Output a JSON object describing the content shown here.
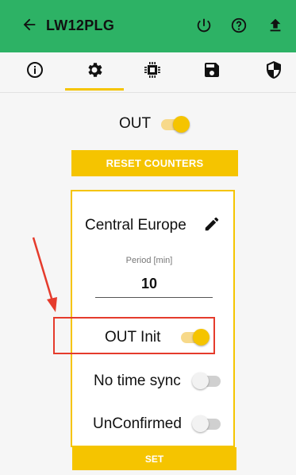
{
  "app": {
    "title": "LW12PLG",
    "accent": "#2db265",
    "icons": [
      "back-arrow-icon",
      "power-icon",
      "help-icon",
      "upload-icon"
    ]
  },
  "tabs": [
    {
      "icon": "info-icon",
      "selected": false
    },
    {
      "icon": "gear-icon",
      "selected": true
    },
    {
      "icon": "chip-icon",
      "selected": false
    },
    {
      "icon": "save-icon",
      "selected": false
    },
    {
      "icon": "shield-icon",
      "selected": false
    }
  ],
  "out_toggle": {
    "label": "OUT",
    "on": true
  },
  "reset_button": {
    "label": "RESET COUNTERS"
  },
  "card": {
    "zone": "Central Europe",
    "period_label": "Period [min]",
    "period_value": "10",
    "out_init": {
      "label": "OUT Init",
      "on": true
    },
    "no_time_sync": {
      "label": "No time sync",
      "on": false
    },
    "unconfirmed": {
      "label": "UnConfirmed",
      "on": false
    },
    "set_button": {
      "label": "SET"
    }
  },
  "colors": {
    "toggle_on": "#f5c400",
    "highlight": "#e53b2c",
    "button": "#f5c400"
  }
}
